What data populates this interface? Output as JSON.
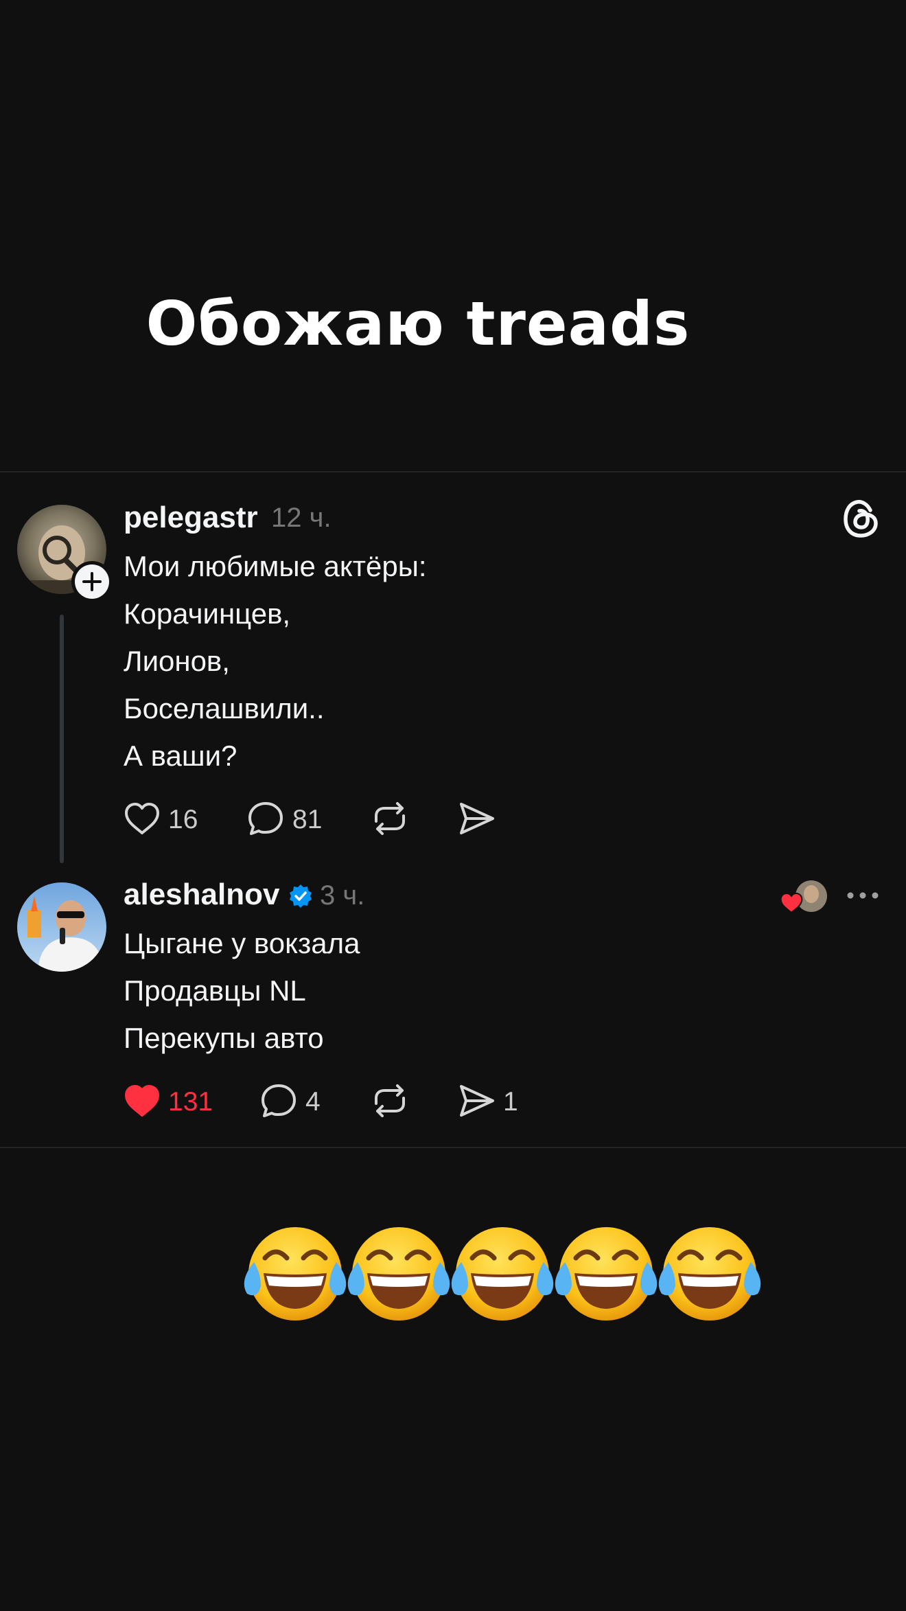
{
  "headline": "Обожаю treads",
  "threads": [
    {
      "username": "pelegastr",
      "time": "12 ч.",
      "lines": [
        "Мои любимые актёры:",
        "Корачинцев,",
        "Лионов,",
        "Боселашвили..",
        "А ваши?"
      ],
      "likes": "16",
      "replies": "81",
      "reposts": "",
      "shares": "",
      "liked": false
    },
    {
      "username": "aleshalnov",
      "verified": true,
      "time": "3 ч.",
      "lines": [
        "Цыгане у вокзала",
        "Продавцы NL",
        "Перекупы авто"
      ],
      "likes": "131",
      "replies": "4",
      "reposts": "",
      "shares": "1",
      "liked": true
    }
  ],
  "icons": {
    "app_logo": "threads-logo-icon",
    "follow": "plus-icon",
    "like": "heart-icon",
    "reply": "speech-bubble-icon",
    "repost": "repost-icon",
    "share": "paper-plane-icon",
    "verified": "verified-badge-icon",
    "more": "more-dots-icon",
    "emoji": "tears-of-joy-emoji"
  },
  "emoji_count": 5,
  "colors": {
    "background": "#101010",
    "text": "#f3f5f7",
    "muted": "#777777",
    "like_active": "#ff3040",
    "verified": "#0095f6"
  }
}
